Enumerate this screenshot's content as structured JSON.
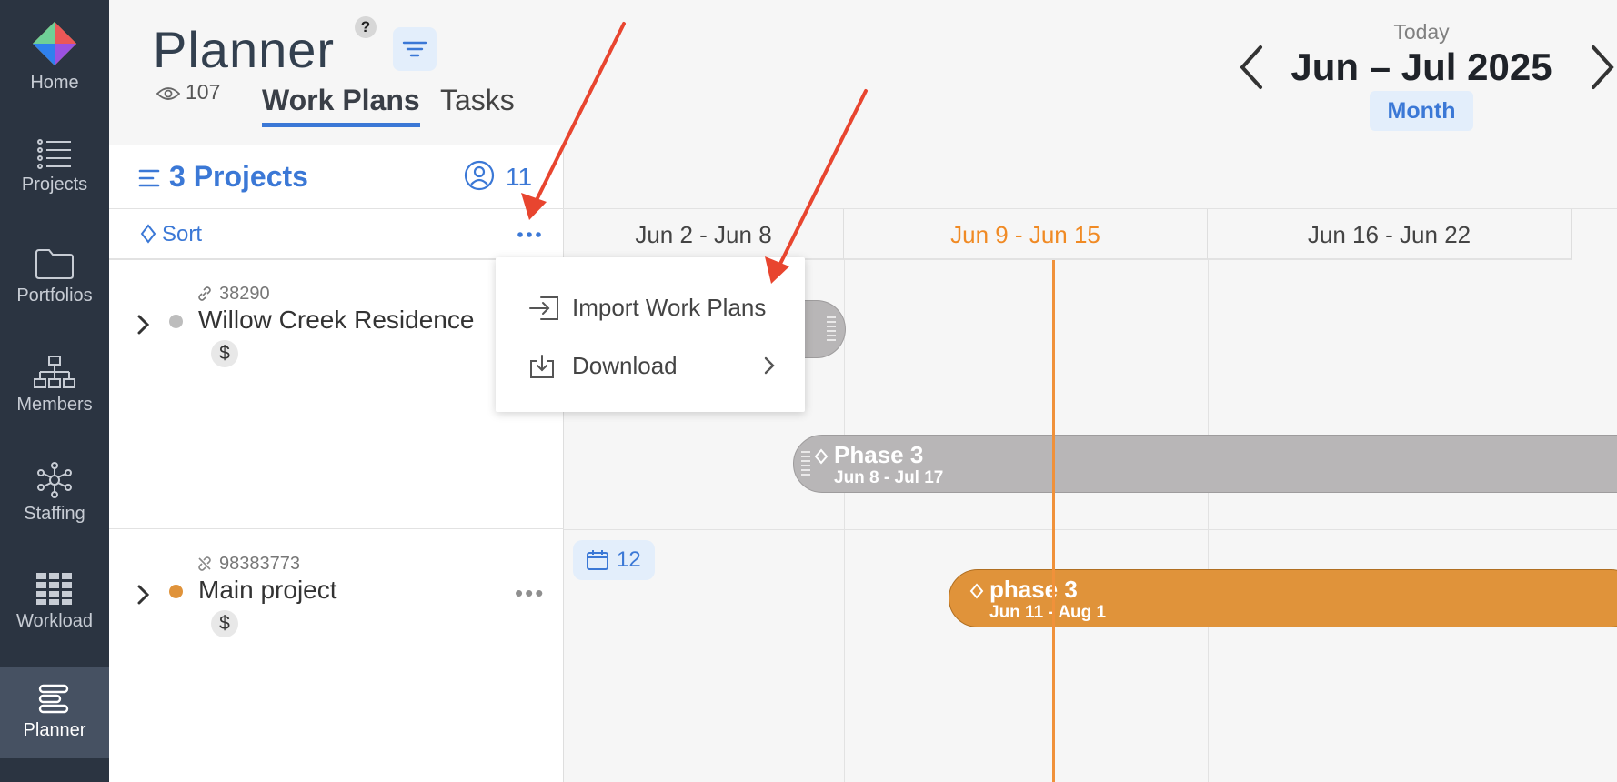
{
  "sidebar": {
    "items": [
      {
        "label": "Home",
        "icon": "app-logo-icon"
      },
      {
        "label": "Projects",
        "icon": "list-icon"
      },
      {
        "label": "Portfolios",
        "icon": "folder-icon"
      },
      {
        "label": "Members",
        "icon": "org-chart-icon"
      },
      {
        "label": "Staffing",
        "icon": "network-icon"
      },
      {
        "label": "Workload",
        "icon": "grid-icon"
      },
      {
        "label": "Planner",
        "icon": "planner-icon",
        "active": true
      }
    ]
  },
  "header": {
    "title": "Planner",
    "help": "?",
    "views": "107",
    "tabs": {
      "work_plans": "Work Plans",
      "tasks": "Tasks"
    },
    "date_nav": {
      "today": "Today",
      "range": "Jun – Jul 2025",
      "view": "Month"
    }
  },
  "left_panel": {
    "projects_label": "3 Projects",
    "members_count": "11",
    "sort_label": "Sort",
    "projects": [
      {
        "id": "38290",
        "name": "Willow Creek Residence",
        "currency": "$",
        "status_color": "#bdbdbd"
      },
      {
        "id": "98383773",
        "name": "Main project",
        "currency": "$",
        "status_color": "#e0933a"
      }
    ]
  },
  "timeline": {
    "weeks": [
      "Jun 2 - Jun 8",
      "Jun 9 - Jun 15",
      "Jun 16 - Jun 22"
    ],
    "current_week": "Jun 9 - Jun 15",
    "bars": [
      {
        "title": "Phase 3",
        "dates": "Jun 8 - Jul 17",
        "color": "#b8b6b7"
      },
      {
        "title": "phase 3",
        "dates": "Jun 11 - Aug 1",
        "color": "#e0933a"
      }
    ],
    "task_count": "12"
  },
  "dropdown": {
    "items": [
      {
        "label": "Import Work Plans",
        "icon": "import-icon"
      },
      {
        "label": "Download",
        "icon": "download-icon",
        "has_submenu": true
      }
    ]
  },
  "colors": {
    "accent": "#3b78d6",
    "today": "#f0913a",
    "annotation": "#e8452f",
    "sidebar": "#2b3441"
  }
}
